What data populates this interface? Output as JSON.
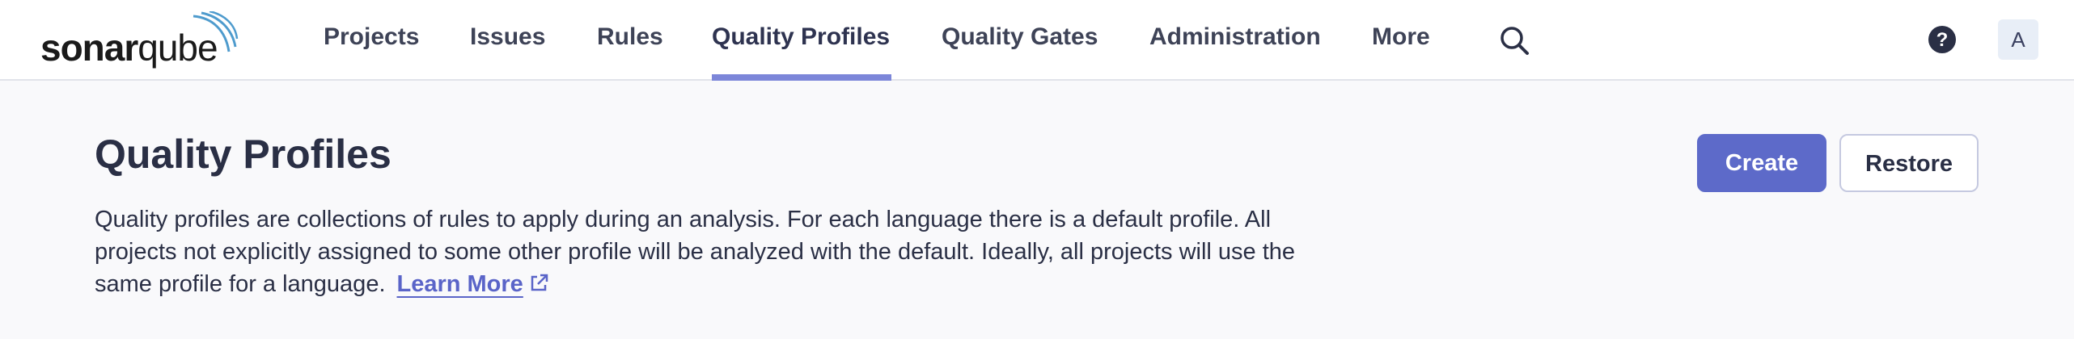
{
  "app": {
    "logo_part1": "sonar",
    "logo_part2": "qube"
  },
  "nav": {
    "items": [
      {
        "label": "Projects"
      },
      {
        "label": "Issues"
      },
      {
        "label": "Rules"
      },
      {
        "label": "Quality Profiles",
        "active": true
      },
      {
        "label": "Quality Gates"
      },
      {
        "label": "Administration"
      },
      {
        "label": "More"
      }
    ],
    "search_icon": "search-icon",
    "help_icon": "help-icon",
    "avatar_initial": "A"
  },
  "page": {
    "title": "Quality Profiles",
    "description": "Quality profiles are collections of rules to apply during an analysis. For each language there is a default profile. All projects not explicitly assigned to some other profile will be analyzed with the default. Ideally, all projects will use the same profile for a language.",
    "learn_more": "Learn More",
    "learn_more_icon": "external-link-icon"
  },
  "actions": {
    "create_label": "Create",
    "restore_label": "Restore"
  },
  "colors": {
    "accent": "#5d6ac9",
    "active_tab_underline": "#7c86d9",
    "background": "#f9f9fb"
  }
}
